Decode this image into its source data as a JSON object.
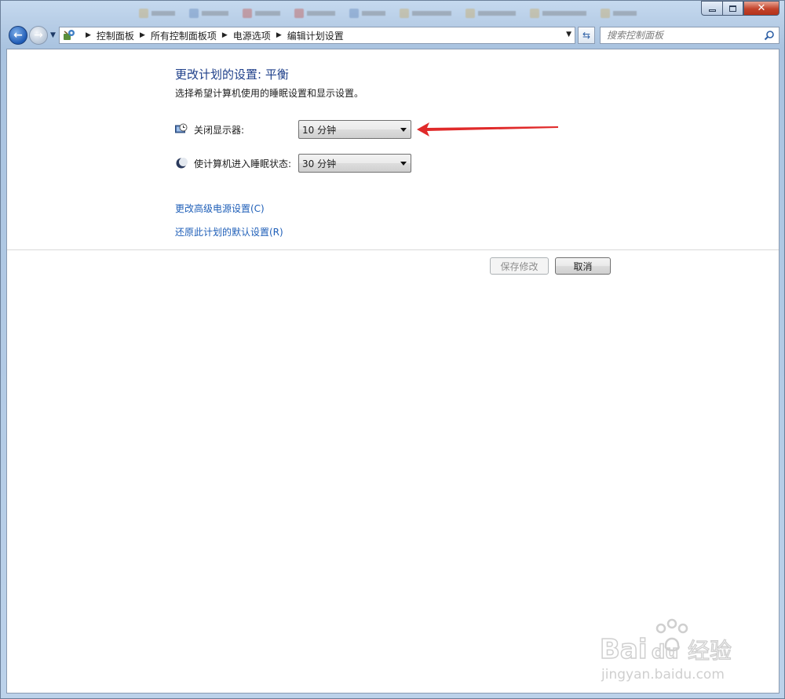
{
  "window": {
    "minimize_label": "▭",
    "maximize_label": "□",
    "close_label": "✕"
  },
  "address_bar": {
    "breadcrumbs": [
      "控制面板",
      "所有控制面板项",
      "电源选项",
      "编辑计划设置"
    ]
  },
  "search": {
    "placeholder": "搜索控制面板"
  },
  "main": {
    "title": "更改计划的设置: 平衡",
    "subtitle": "选择希望计算机使用的睡眠设置和显示设置。",
    "settings": [
      {
        "label": "关闭显示器:",
        "value": "10 分钟",
        "icon": "monitor-clock-icon"
      },
      {
        "label": "使计算机进入睡眠状态:",
        "value": "30 分钟",
        "icon": "moon-icon"
      }
    ],
    "links": {
      "advanced": "更改高级电源设置(C)",
      "restore": "还原此计划的默认设置(R)"
    },
    "buttons": {
      "save": "保存修改",
      "cancel": "取消"
    }
  },
  "watermark": {
    "brand": "Bai du 经验",
    "url": "jingyan.baidu.com"
  },
  "colors": {
    "title": "#1e3f8a",
    "link": "#1f5fb8",
    "annotation": "#e02a2a"
  }
}
